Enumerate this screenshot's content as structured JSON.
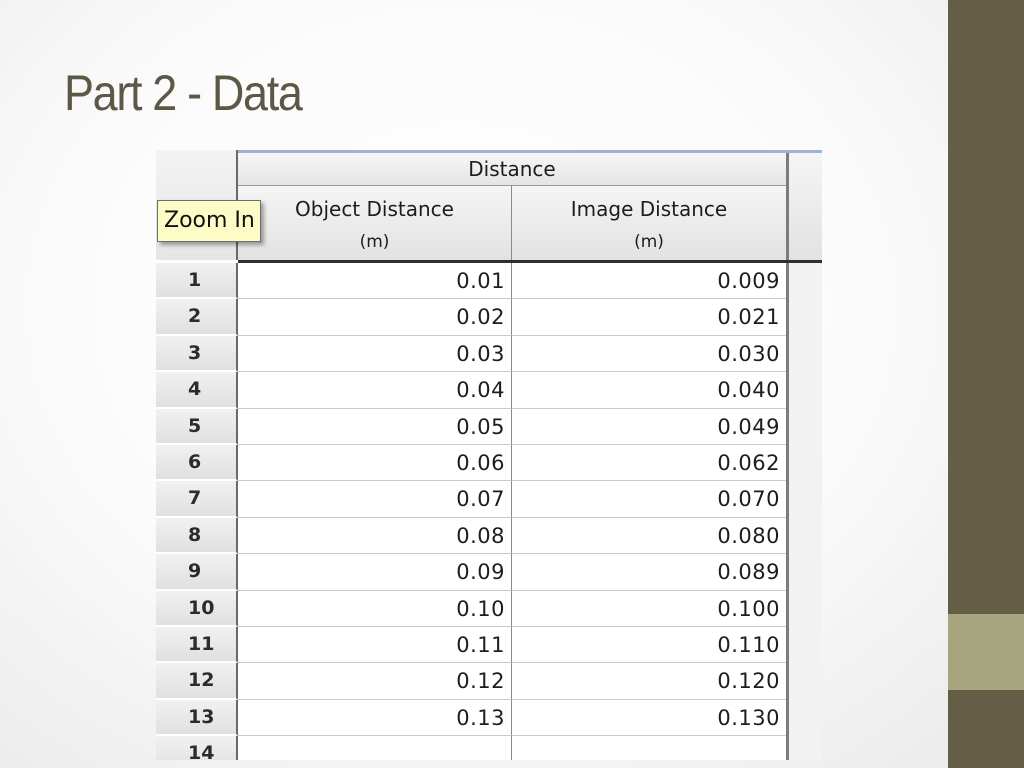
{
  "slide": {
    "title": "Part 2 - Data"
  },
  "table": {
    "group_header": "Distance",
    "columns": [
      {
        "line1": "Object Distance",
        "line2": "(m)"
      },
      {
        "line1": "Image Distance",
        "line2": "(m)"
      }
    ],
    "rows": [
      {
        "n": "1",
        "obj": "0.01",
        "img": "0.009"
      },
      {
        "n": "2",
        "obj": "0.02",
        "img": "0.021"
      },
      {
        "n": "3",
        "obj": "0.03",
        "img": "0.030"
      },
      {
        "n": "4",
        "obj": "0.04",
        "img": "0.040"
      },
      {
        "n": "5",
        "obj": "0.05",
        "img": "0.049"
      },
      {
        "n": "6",
        "obj": "0.06",
        "img": "0.062"
      },
      {
        "n": "7",
        "obj": "0.07",
        "img": "0.070"
      },
      {
        "n": "8",
        "obj": "0.08",
        "img": "0.080"
      },
      {
        "n": "9",
        "obj": "0.09",
        "img": "0.089"
      },
      {
        "n": "10",
        "obj": "0.10",
        "img": "0.100"
      },
      {
        "n": "11",
        "obj": "0.11",
        "img": "0.110"
      },
      {
        "n": "12",
        "obj": "0.12",
        "img": "0.120"
      },
      {
        "n": "13",
        "obj": "0.13",
        "img": "0.130"
      },
      {
        "n": "14",
        "obj": "",
        "img": ""
      }
    ]
  },
  "tooltip": {
    "text": "Zoom In"
  },
  "colors": {
    "title": "#5c5845",
    "sidebar": "#655e46",
    "sidebar_accent": "#a7a480",
    "tooltip_bg": "#fdfbc6"
  }
}
